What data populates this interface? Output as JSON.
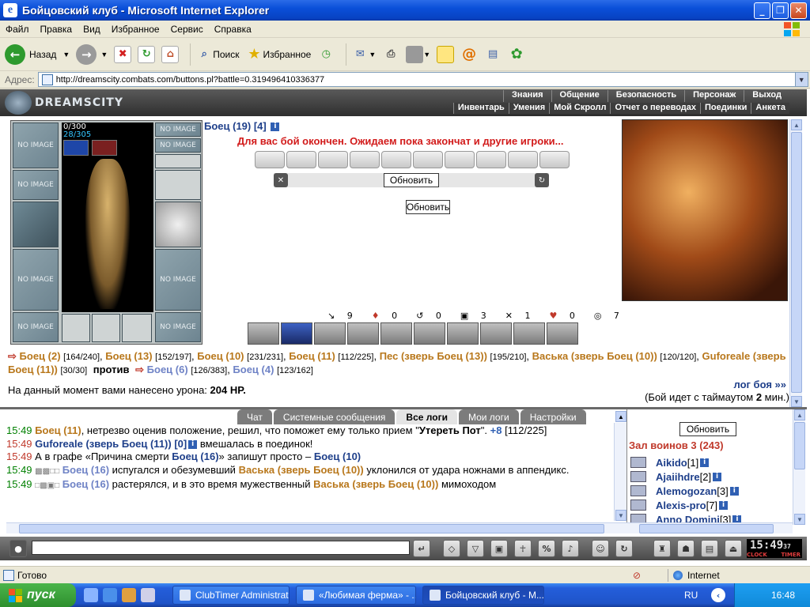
{
  "window": {
    "title": "Бойцовский клуб - Microsoft Internet Explorer"
  },
  "menu": [
    "Файл",
    "Правка",
    "Вид",
    "Избранное",
    "Сервис",
    "Справка"
  ],
  "toolbar": {
    "back_label": "Назад",
    "search_label": "Поиск",
    "favorites_label": "Избранное"
  },
  "address": {
    "label": "Адрес:",
    "url": "http://dreamscity.combats.com/buttons.pl?battle=0.319496410336377"
  },
  "site": {
    "logo": "DREAMSCITY",
    "nav_top": [
      "Знания",
      "Общение",
      "Безопасность",
      "Персонаж",
      "Выход"
    ],
    "nav_bottom": [
      "Инвентарь",
      "Умения",
      "Мой Скролл",
      "Отчет о переводах",
      "Поединки",
      "Анкета"
    ]
  },
  "character": {
    "hp": "0/300",
    "mana": "28/305",
    "slot_label": "NO IMAGE"
  },
  "battle": {
    "fighter_name": "Боец (19) [4]",
    "info_mark": "i",
    "message": "Для вас бой окончен. Ожидаем пока закончат и другие игроки...",
    "refresh_label": "Обновить",
    "refresh_label2": "Обновить",
    "stats": [
      "9",
      "0",
      "0",
      "3",
      "1",
      "0",
      "7"
    ],
    "stat_icons": [
      "↘",
      "♦",
      "↺",
      "▣",
      "✕",
      "♥",
      "◎"
    ]
  },
  "teams": {
    "team1": [
      {
        "name": "Боец (2)",
        "hp": "[164/240]"
      },
      {
        "name": "Боец (13)",
        "hp": "[152/197]"
      },
      {
        "name": "Боец (10)",
        "hp": "[231/231]"
      },
      {
        "name": "Боец (11)",
        "hp": "[112/225]"
      },
      {
        "name": "Пес (зверь Боец (13))",
        "hp": "[195/210]"
      },
      {
        "name": "Васька (зверь Боец (10))",
        "hp": "[120/120]"
      },
      {
        "name": "Guforeale (зверь Боец (11))",
        "hp": "[30/30]"
      }
    ],
    "vs_label": "против",
    "team2": [
      {
        "name": "Боец (6)",
        "hp": "[126/383]"
      },
      {
        "name": "Боец (4)",
        "hp": "[123/162]"
      }
    ]
  },
  "damage": {
    "text": "На данный момент вами нанесено урона:",
    "value": "204 HP."
  },
  "log_link": "лог боя »»",
  "timeout": {
    "prefix": "(Бой идет с таймаутом",
    "value": "2",
    "suffix": "мин.)"
  },
  "tabs": [
    "Чат",
    "Системные сообщения",
    "Все логи",
    "Мои логи",
    "Настройки"
  ],
  "log": {
    "l1_time": "15:49",
    "l1_actor": "Боец (11)",
    "l1_text": ", нетрезво оценив положение, решил, что поможет ему только прием \"",
    "l1_move": "Утереть Пот",
    "l1_end": "\".",
    "l1_gain": "+8",
    "l1_hp": "[112/225]",
    "l2_time": "15:49",
    "l2_actor": "Guforeale (зверь Боец (11)) [0]",
    "l2_text": "вмешалась в поединок!",
    "l3_time": "15:49",
    "l3_a": "А в графе «Причина смерти",
    "l3_actor": "Боец (16)",
    "l3_b": "» запишут просто –",
    "l3_actor2": "Боец (10)",
    "l4_time": "15:49",
    "l4_actor": "Боец (16)",
    "l4_text": "испугался и обезумевший",
    "l4_actor2": "Васька (зверь Боец (10))",
    "l4_text2": "уклонился от удара ножнами в аппендикс.",
    "l5_time": "15:49",
    "l5_actor": "Боец (16)",
    "l5_text": "растерялся, и в это время мужественный",
    "l5_actor2": "Васька (зверь Боец (10))",
    "l5_text2": "мимоходом"
  },
  "room": {
    "refresh_label": "Обновить",
    "title": "Зал воинов 3 (243)",
    "players": [
      {
        "name": "Aikido",
        "level": "[1]"
      },
      {
        "name": "Ajaiihdre",
        "level": "[2]"
      },
      {
        "name": "Alemogozan",
        "level": "[3]"
      },
      {
        "name": "Alexis-pro",
        "level": "[7]"
      },
      {
        "name": "Anno Domini",
        "level": "[3]"
      }
    ]
  },
  "clock": {
    "time": "15:49",
    "sec": "37",
    "label1": "CLOCK",
    "label2": "TIMER"
  },
  "status": {
    "ready": "Готово",
    "zone": "Internet"
  },
  "taskbar": {
    "start_label": "пуск",
    "items": [
      "ClubTimer Administrat...",
      "«Любимая ферма» - ...",
      "Бойцовский клуб - M..."
    ],
    "lang": "RU",
    "time": "16:48"
  }
}
